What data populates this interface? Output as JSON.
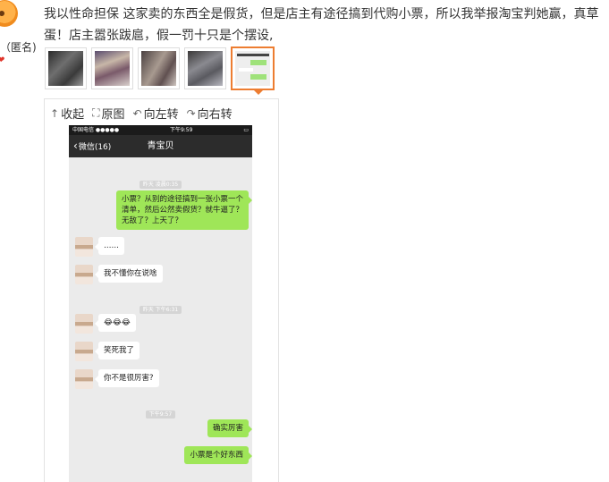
{
  "post": {
    "author_label": "（匿名)",
    "text": "我以性命担保 这家卖的东西全是假货，但是店主有途径搞到代购小票，所以我举报淘宝判她赢，真草蛋！店主嚣张跋扈，假一罚十只是个摆设,"
  },
  "viewer": {
    "toolbar": [
      {
        "icon": "arrow-up-icon",
        "glyph": "↑",
        "label": "收起"
      },
      {
        "icon": "expand-icon",
        "glyph": "⛶",
        "label": "原图"
      },
      {
        "icon": "rotate-left-icon",
        "glyph": "↶",
        "label": "向左转"
      },
      {
        "icon": "rotate-right-icon",
        "glyph": "↷",
        "label": "向右转"
      }
    ]
  },
  "phone": {
    "status_left": "中国电信 ●●●●● ",
    "status_time": "下午9:59",
    "status_right": "▭",
    "back_label": "微信(16)",
    "chat_title": "青宝贝",
    "timestamps": [
      "昨天 凌晨0:35",
      "昨天 下午6:31",
      "下午9:57"
    ],
    "messages": [
      {
        "side": "right",
        "text": "小票？从别的途径搞到一张小票一个清单，然后公然卖假货？就牛逼了？无敌了？上天了？"
      },
      {
        "side": "left",
        "text": "……"
      },
      {
        "side": "left",
        "text": "我不懂你在说啥"
      },
      {
        "side": "left",
        "text": "😂😂😂"
      },
      {
        "side": "left",
        "text": "笑死我了"
      },
      {
        "side": "left",
        "text": "你不是很厉害?"
      },
      {
        "side": "right",
        "text": "确实厉害"
      },
      {
        "side": "right",
        "text": "小票是个好东西"
      }
    ]
  },
  "colors": {
    "accent": "#ed7d31",
    "bubble_green": "#9fe658",
    "navbar": "#2c2c2c"
  }
}
